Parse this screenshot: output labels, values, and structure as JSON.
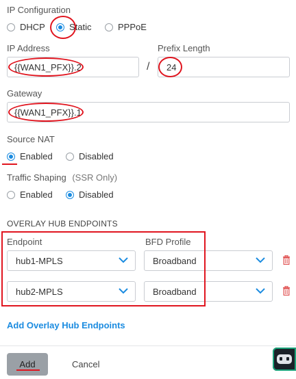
{
  "ip_config": {
    "label": "IP Configuration",
    "options": [
      "DHCP",
      "Static",
      "PPPoE"
    ],
    "selected": "Static"
  },
  "ip_address": {
    "label": "IP Address",
    "value": "{{WAN1_PFX}}.2",
    "prefix_label": "Prefix Length",
    "prefix_value": "24",
    "separator": "/"
  },
  "gateway": {
    "label": "Gateway",
    "value": "{{WAN1_PFX}}.1"
  },
  "source_nat": {
    "label": "Source NAT",
    "options": [
      "Enabled",
      "Disabled"
    ],
    "selected": "Enabled"
  },
  "traffic_shaping": {
    "label": "Traffic Shaping",
    "note": "(SSR Only)",
    "options": [
      "Enabled",
      "Disabled"
    ],
    "selected": "Disabled"
  },
  "overlay": {
    "section_title": "OVERLAY HUB ENDPOINTS",
    "endpoint_header": "Endpoint",
    "bfd_header": "BFD Profile",
    "rows": [
      {
        "endpoint": "hub1-MPLS",
        "bfd": "Broadband"
      },
      {
        "endpoint": "hub2-MPLS",
        "bfd": "Broadband"
      }
    ],
    "add_link": "Add Overlay Hub Endpoints"
  },
  "footer": {
    "add_label": "Add",
    "cancel_label": "Cancel"
  },
  "colors": {
    "accent": "#1a8be0",
    "annotation_red": "#e0141e",
    "link_blue": "#1a8be0"
  }
}
